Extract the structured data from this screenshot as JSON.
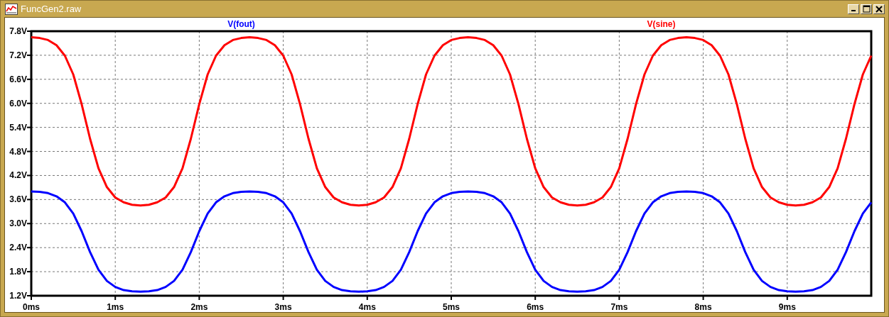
{
  "window": {
    "title": "FuncGen2.raw"
  },
  "plot": {
    "chart_data": {
      "type": "line",
      "x": [
        0,
        0.1,
        0.2,
        0.3,
        0.4,
        0.5,
        0.6,
        0.7,
        0.8,
        0.9,
        1,
        1.1,
        1.2,
        1.3,
        1.4,
        1.5,
        1.6,
        1.7,
        1.8,
        1.9,
        2,
        2.1,
        2.2,
        2.3,
        2.4,
        2.5,
        2.6,
        2.7,
        2.8,
        2.9,
        3,
        3.1,
        3.2,
        3.3,
        3.4,
        3.5,
        3.6,
        3.7,
        3.8,
        3.9,
        4,
        4.1,
        4.2,
        4.3,
        4.4,
        4.5,
        4.6,
        4.7,
        4.8,
        4.9,
        5,
        5.1,
        5.2,
        5.3,
        5.4,
        5.5,
        5.6,
        5.7,
        5.8,
        5.9,
        6,
        6.1,
        6.2,
        6.3,
        6.4,
        6.5,
        6.6,
        6.7,
        6.8,
        6.9,
        7,
        7.1,
        7.2,
        7.3,
        7.4,
        7.5,
        7.6,
        7.7,
        7.8,
        7.9,
        8,
        8.1,
        8.2,
        8.3,
        8.4,
        8.5,
        8.6,
        8.7,
        8.8,
        8.9,
        9,
        9.1,
        9.2,
        9.3,
        9.4,
        9.5,
        9.6,
        9.7,
        9.8,
        9.9,
        10
      ],
      "series": [
        {
          "name": "V(fout)",
          "color": "#0000ff",
          "values": [
            3.8,
            3.79,
            3.76,
            3.68,
            3.53,
            3.25,
            2.81,
            2.29,
            1.85,
            1.57,
            1.42,
            1.34,
            1.31,
            1.3,
            1.31,
            1.34,
            1.42,
            1.57,
            1.85,
            2.29,
            2.81,
            3.25,
            3.53,
            3.68,
            3.76,
            3.79,
            3.8,
            3.79,
            3.76,
            3.68,
            3.53,
            3.25,
            2.81,
            2.29,
            1.85,
            1.57,
            1.42,
            1.34,
            1.31,
            1.3,
            1.31,
            1.34,
            1.42,
            1.57,
            1.85,
            2.29,
            2.81,
            3.25,
            3.53,
            3.68,
            3.76,
            3.79,
            3.8,
            3.79,
            3.76,
            3.68,
            3.53,
            3.25,
            2.81,
            2.29,
            1.85,
            1.57,
            1.42,
            1.34,
            1.31,
            1.3,
            1.31,
            1.34,
            1.42,
            1.57,
            1.85,
            2.29,
            2.81,
            3.25,
            3.53,
            3.68,
            3.76,
            3.79,
            3.8,
            3.79,
            3.76,
            3.68,
            3.53,
            3.25,
            2.81,
            2.29,
            1.85,
            1.57,
            1.42,
            1.34,
            1.31,
            1.3,
            1.31,
            1.34,
            1.42,
            1.57,
            1.85,
            2.29,
            2.81,
            3.25,
            3.53
          ]
        },
        {
          "name": "V(sine)",
          "color": "#ff0000",
          "values": [
            7.65,
            7.63,
            7.58,
            7.45,
            7.19,
            6.72,
            5.98,
            5.12,
            4.38,
            3.91,
            3.65,
            3.53,
            3.47,
            3.45,
            3.47,
            3.53,
            3.65,
            3.91,
            4.38,
            5.12,
            5.98,
            6.72,
            7.19,
            7.45,
            7.58,
            7.63,
            7.65,
            7.63,
            7.58,
            7.45,
            7.19,
            6.72,
            5.98,
            5.12,
            4.38,
            3.91,
            3.65,
            3.53,
            3.47,
            3.45,
            3.47,
            3.53,
            3.65,
            3.91,
            4.38,
            5.12,
            5.98,
            6.72,
            7.19,
            7.45,
            7.58,
            7.63,
            7.65,
            7.63,
            7.58,
            7.45,
            7.19,
            6.72,
            5.98,
            5.12,
            4.38,
            3.91,
            3.65,
            3.53,
            3.47,
            3.45,
            3.47,
            3.53,
            3.65,
            3.91,
            4.38,
            5.12,
            5.98,
            6.72,
            7.19,
            7.45,
            7.58,
            7.63,
            7.65,
            7.63,
            7.58,
            7.45,
            7.19,
            6.72,
            5.98,
            5.12,
            4.38,
            3.91,
            3.65,
            3.53,
            3.47,
            3.45,
            3.47,
            3.53,
            3.65,
            3.91,
            4.38,
            5.12,
            5.98,
            6.72,
            7.19
          ]
        }
      ],
      "grid": true,
      "xlim": [
        0,
        10
      ],
      "ylim": [
        1.2,
        7.8
      ],
      "xticks": [
        {
          "value": 0,
          "label": "0ms"
        },
        {
          "value": 1,
          "label": "1ms"
        },
        {
          "value": 2,
          "label": "2ms"
        },
        {
          "value": 3,
          "label": "3ms"
        },
        {
          "value": 4,
          "label": "4ms"
        },
        {
          "value": 5,
          "label": "5ms"
        },
        {
          "value": 6,
          "label": "6ms"
        },
        {
          "value": 7,
          "label": "7ms"
        },
        {
          "value": 8,
          "label": "8ms"
        },
        {
          "value": 9,
          "label": "9ms"
        }
      ],
      "yticks": [
        {
          "value": 1.2,
          "label": "1.2V"
        },
        {
          "value": 1.8,
          "label": "1.8V"
        },
        {
          "value": 2.4,
          "label": "2.4V"
        },
        {
          "value": 3,
          "label": "3.0V"
        },
        {
          "value": 3.6,
          "label": "3.6V"
        },
        {
          "value": 4.2,
          "label": "4.2V"
        },
        {
          "value": 4.8,
          "label": "4.8V"
        },
        {
          "value": 5.4,
          "label": "5.4V"
        },
        {
          "value": 6,
          "label": "6.0V"
        },
        {
          "value": 6.6,
          "label": "6.6V"
        },
        {
          "value": 7.2,
          "label": "7.2V"
        },
        {
          "value": 7.8,
          "label": "7.8V"
        }
      ]
    }
  }
}
